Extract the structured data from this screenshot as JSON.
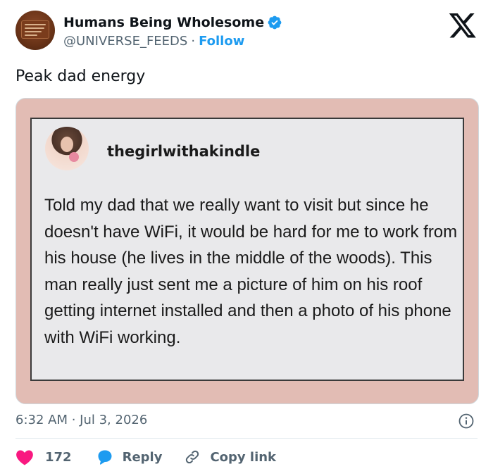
{
  "account": {
    "display_name": "Humans Being Wholesome",
    "handle": "@UNIVERSE_FEEDS",
    "separator": "·",
    "follow_label": "Follow"
  },
  "tweet": {
    "text": "Peak dad energy",
    "timestamp": "6:32 AM · Jul 3, 2026"
  },
  "embedded_post": {
    "username": "thegirlwithakindle",
    "body": "Told my dad that we really want to visit but since he doesn't have WiFi, it would be hard for me to work from his house (he lives in the middle of the woods). This man really just sent me a picture of him on his roof getting internet installed and then a photo of his phone with WiFi working."
  },
  "actions": {
    "like_count": "172",
    "reply_label": "Reply",
    "copy_link_label": "Copy link"
  },
  "colors": {
    "accent": "#1d9bf0",
    "like": "#f91880",
    "media_background": "#e2bcb4",
    "muted_text": "#536471"
  }
}
